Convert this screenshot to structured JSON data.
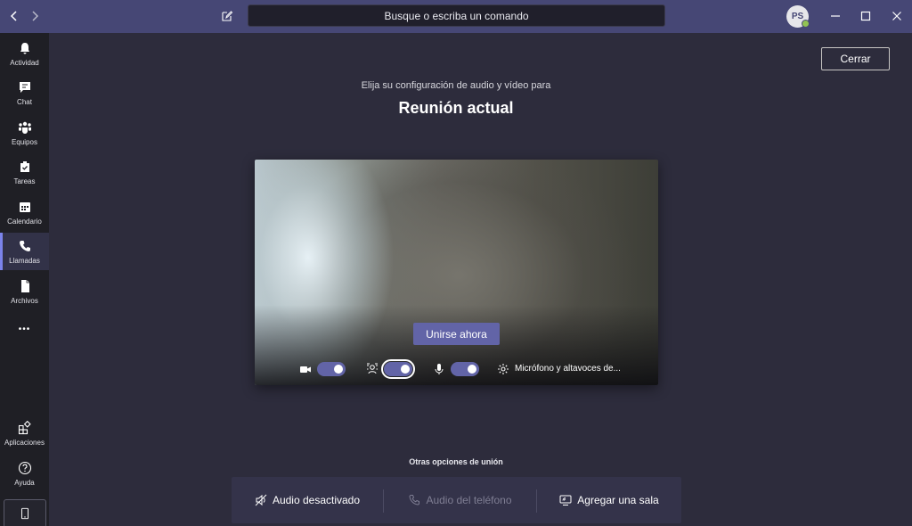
{
  "titlebar": {
    "search_placeholder": "Busque o escriba un comando",
    "avatar_initials": "PS",
    "presence_color": "#92c353",
    "accent_color": "#464775"
  },
  "rail": {
    "items": [
      {
        "label": "Actividad",
        "icon": "bell-icon"
      },
      {
        "label": "Chat",
        "icon": "chat-icon"
      },
      {
        "label": "Equipos",
        "icon": "teams-icon"
      },
      {
        "label": "Tareas",
        "icon": "tasks-icon"
      },
      {
        "label": "Calendario",
        "icon": "calendar-icon"
      },
      {
        "label": "Llamadas",
        "icon": "phone-icon",
        "active": true
      },
      {
        "label": "Archivos",
        "icon": "files-icon"
      }
    ],
    "more_label": "•••",
    "bottom": [
      {
        "label": "Aplicaciones",
        "icon": "apps-icon"
      },
      {
        "label": "Ayuda",
        "icon": "help-icon"
      }
    ]
  },
  "main": {
    "close_label": "Cerrar",
    "subtitle": "Elija su configuración de audio y vídeo para",
    "title": "Reunión actual"
  },
  "preview": {
    "join_label": "Unirse ahora",
    "camera_on": true,
    "blur_on": true,
    "mic_on": true,
    "device_label": "Micrófono y altavoces de..."
  },
  "other_options": {
    "title": "Otras opciones de unión",
    "options": [
      {
        "label": "Audio desactivado",
        "icon": "speaker-off-icon",
        "enabled": true
      },
      {
        "label": "Audio del teléfono",
        "icon": "phone-icon",
        "enabled": false
      },
      {
        "label": "Agregar una sala",
        "icon": "cast-icon",
        "enabled": true
      }
    ]
  },
  "colors": {
    "primary": "#6264a7",
    "background": "#2d2c3c",
    "rail": "#1f1f25"
  }
}
